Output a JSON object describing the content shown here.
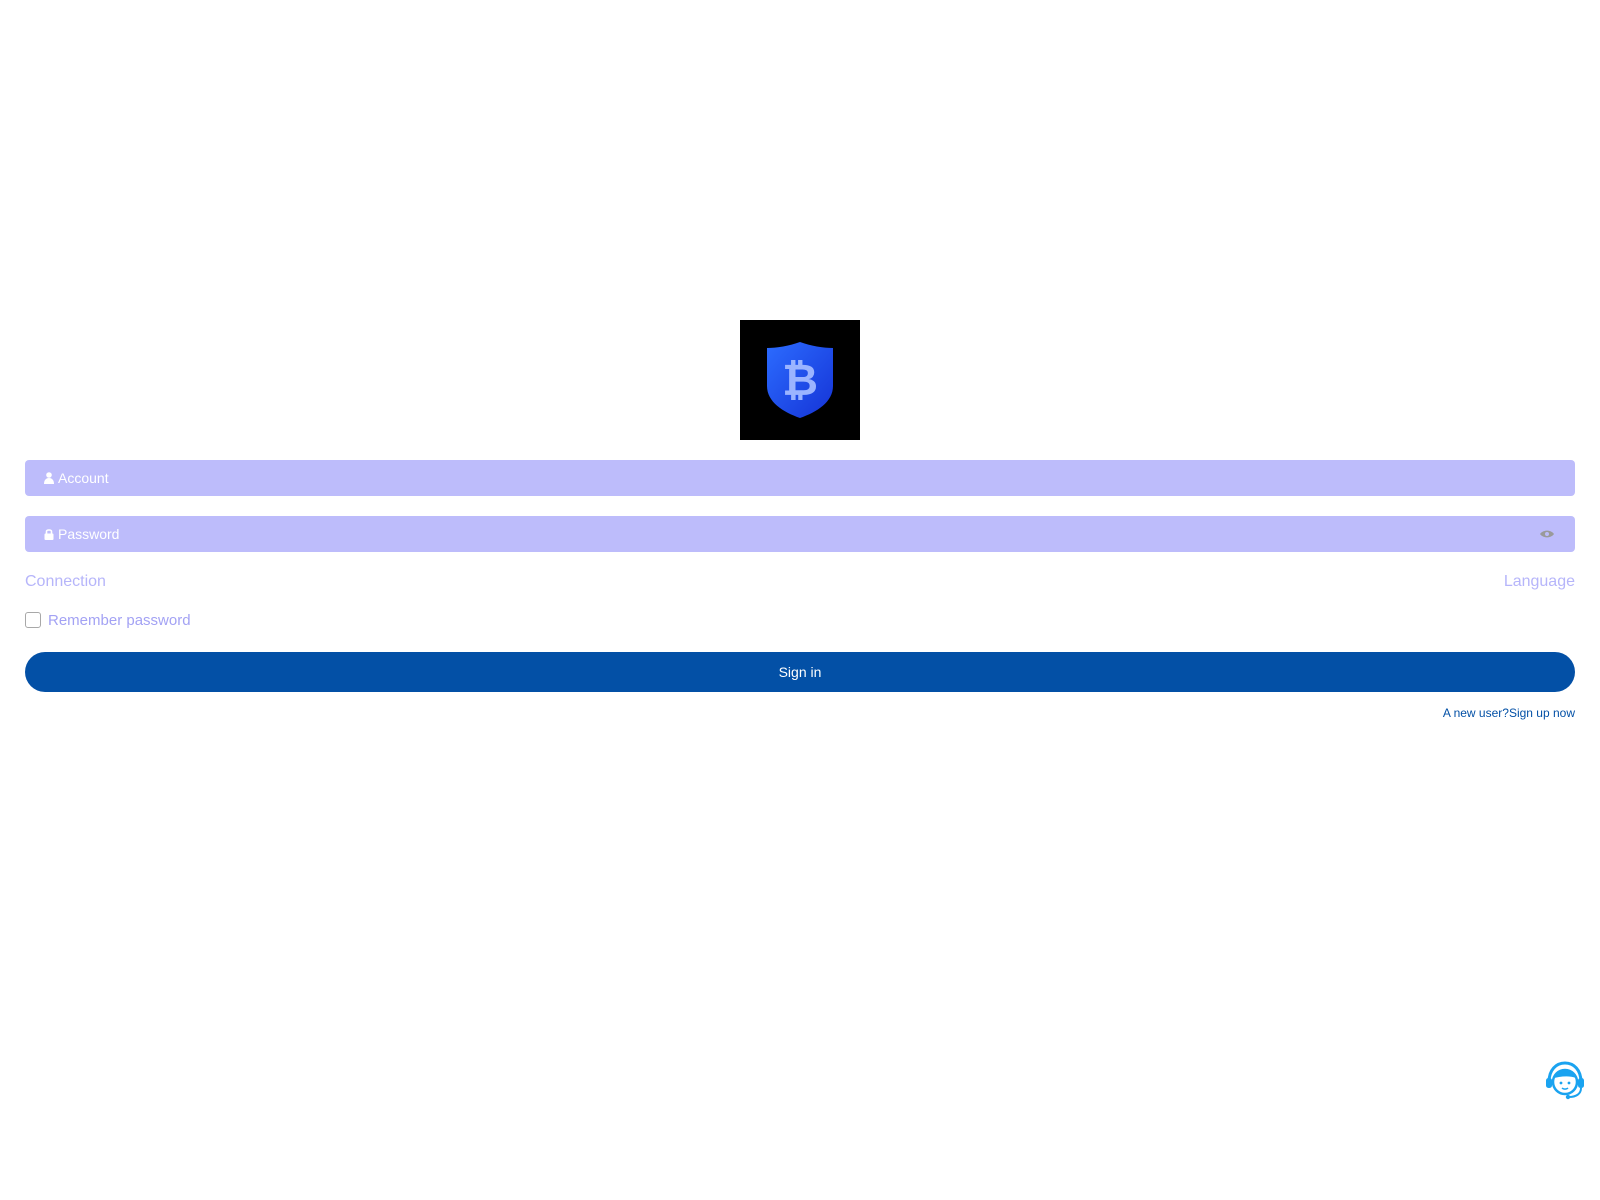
{
  "logo": {
    "icon": "bitcoin-shield-icon",
    "background": "#000000",
    "accent": "#2251f0"
  },
  "form": {
    "account_placeholder": "Account",
    "account_icon": "user-icon",
    "password_placeholder": "Password",
    "password_icon": "lock-icon",
    "toggle_visibility_icon": "eye-icon",
    "field_color": "#bdbcfb"
  },
  "links": {
    "connection": "Connection",
    "language": "Language",
    "link_color": "#b6b5fa"
  },
  "remember": {
    "label": "Remember password",
    "checked": false
  },
  "signin": {
    "label": "Sign in",
    "color": "#0350a6"
  },
  "signup": {
    "label": "A new user?Sign up now"
  },
  "support": {
    "icon": "customer-service-icon",
    "color": "#1aa3f0"
  }
}
